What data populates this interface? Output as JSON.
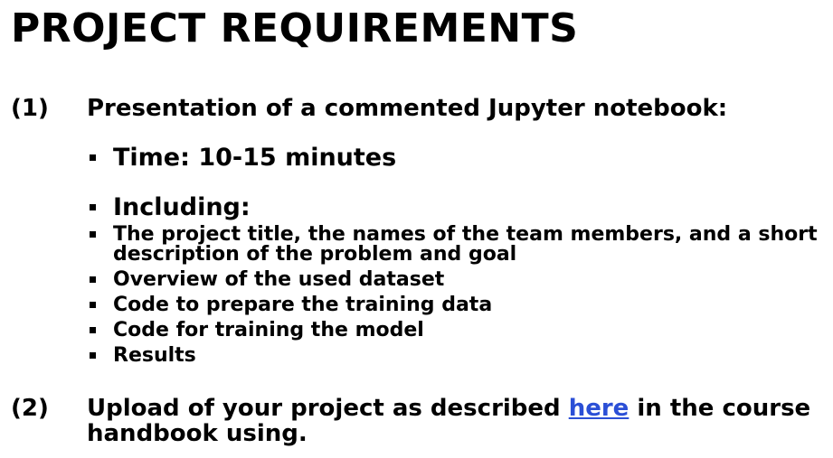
{
  "title": "PROJECT REQUIREMENTS",
  "requirement_1": {
    "number": "(1)",
    "text": "Presentation of a commented Jupyter notebook:",
    "time_item": "Time: 10-15 minutes",
    "including_item": "Including:",
    "included_items": [
      "The project title, the names of the team members, and a short description of the problem and goal",
      "Overview of the used dataset",
      "Code to prepare the training data",
      "Code for training the model",
      "Results"
    ]
  },
  "requirement_2": {
    "number": "(2)",
    "text_before_link": "Upload of your project as described ",
    "link_text": "here",
    "text_after_link": " in the course handbook using."
  },
  "colors": {
    "text": "#000000",
    "link": "#2b4fd6",
    "background": "#ffffff"
  }
}
